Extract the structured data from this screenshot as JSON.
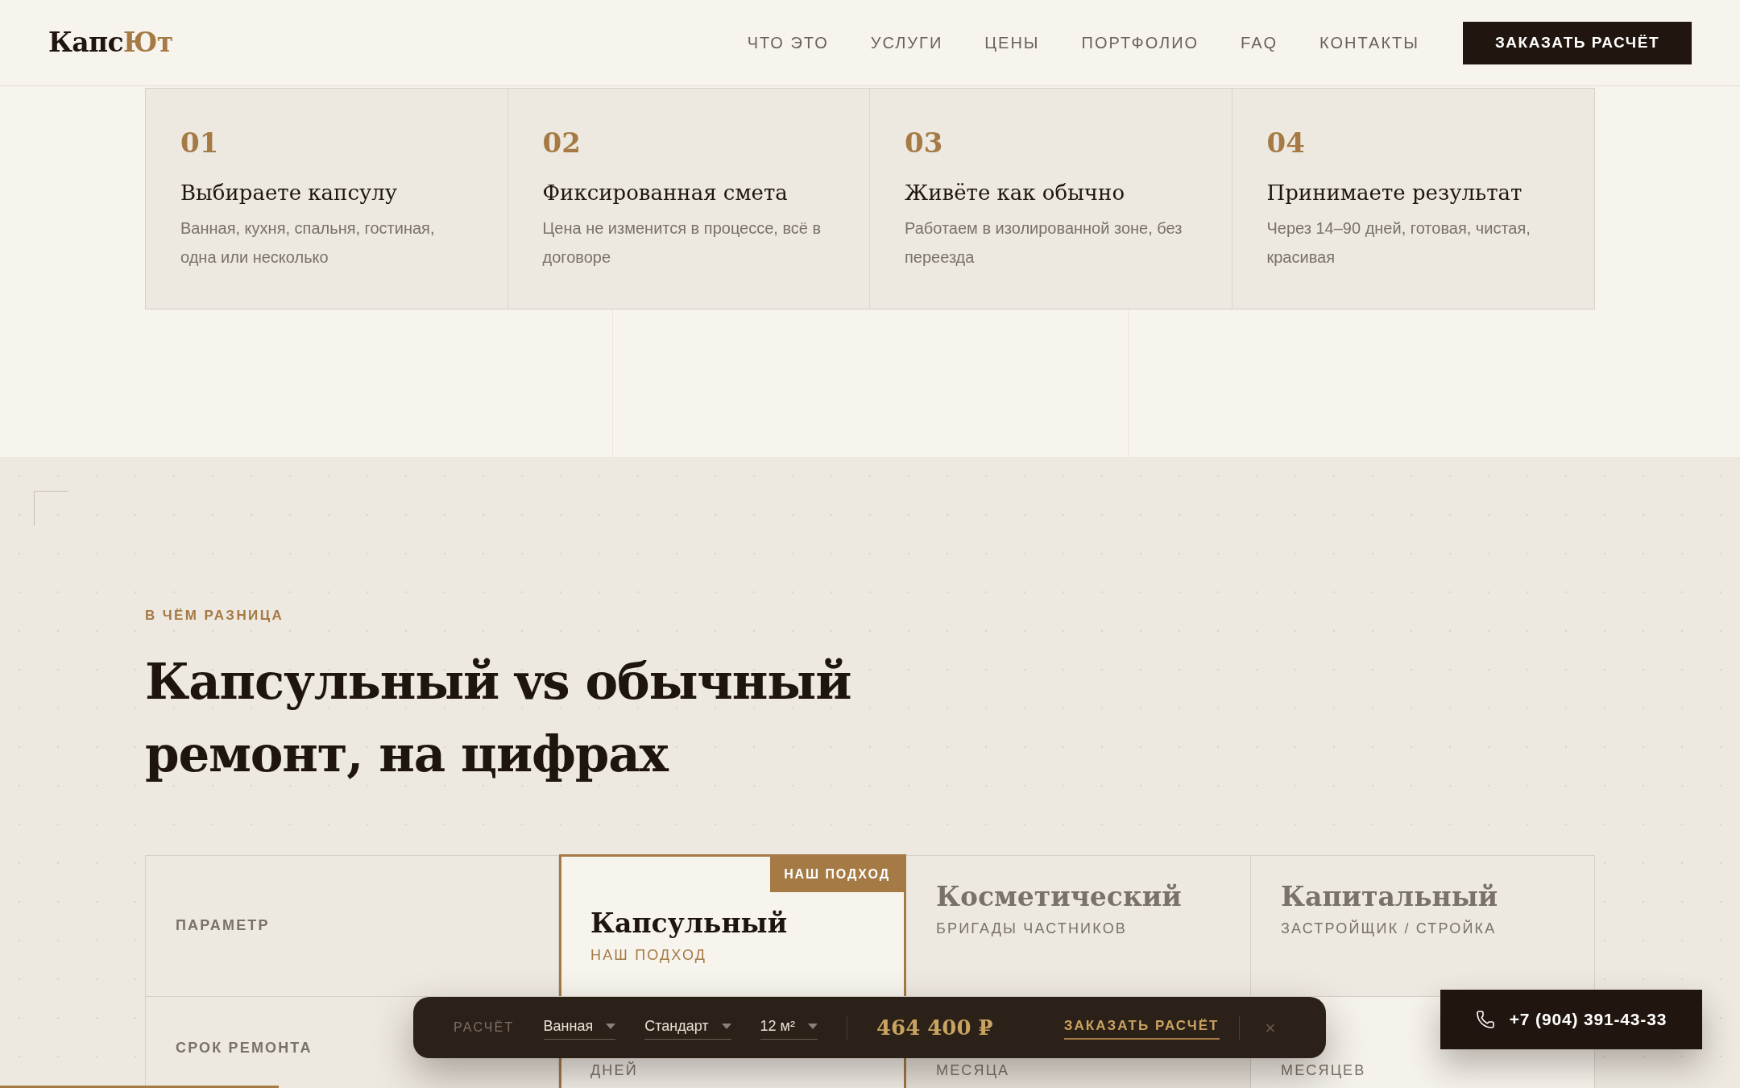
{
  "header": {
    "logo": {
      "part_1": "Капс",
      "part_2": "Ют"
    },
    "nav": [
      "ЧТО ЭТО",
      "УСЛУГИ",
      "ЦЕНЫ",
      "ПОРТФОЛИО",
      "FAQ",
      "КОНТАКТЫ"
    ],
    "cta": "ЗАКАЗАТЬ РАСЧЁТ"
  },
  "steps": [
    {
      "number": "01",
      "title": "Выбираете капсулу",
      "description": "Ванная, кухня, спальня, гостиная, одна или несколько"
    },
    {
      "number": "02",
      "title": "Фиксированная смета",
      "description": "Цена не изменится в процессе, всё в договоре"
    },
    {
      "number": "03",
      "title": "Живёте как обычно",
      "description": "Работаем в изолированной зоне, без переезда"
    },
    {
      "number": "04",
      "title": "Принимаете результат",
      "description": "Через 14–90 дней, готовая, чистая, красивая"
    }
  ],
  "comparison": {
    "eyebrow": "В ЧЁМ РАЗНИЦА",
    "title": "Капсульный vs обычный\nремонт, на цифрах",
    "columns": [
      {
        "kind": "param",
        "label": "ПАРАМЕТР"
      },
      {
        "kind": "featured",
        "title": "Капсульный",
        "subtitle": "НАШ ПОДХОД",
        "badge": "НАШ ПОДХОД"
      },
      {
        "kind": "plain",
        "title": "Косметический",
        "subtitle": "БРИГАДЫ ЧАСТНИКОВ"
      },
      {
        "kind": "plain",
        "title": "Капитальный",
        "subtitle": "ЗАСТРОЙЩИК / СТРОЙКА"
      }
    ],
    "rows": [
      {
        "cells": [
          "СРОК РЕМОНТА",
          "ДНЕЙ",
          "МЕСЯЦА",
          "МЕСЯЦЕВ"
        ]
      }
    ]
  },
  "calculator": {
    "label": "РАСЧЁТ",
    "selects": [
      "Ванная",
      "Стандарт",
      "12 м²"
    ],
    "price": "464 400 ₽",
    "order_link": "ЗАКАЗАТЬ РАСЧЁТ",
    "close": "×"
  },
  "phone_button": "+7 (904) 391-43-33",
  "scroll_progress": {
    "level": 0.16
  }
}
